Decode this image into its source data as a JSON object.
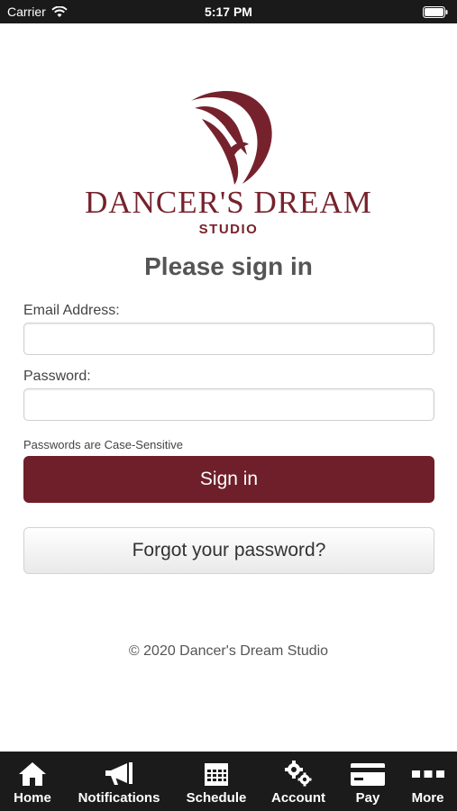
{
  "status_bar": {
    "carrier": "Carrier",
    "time": "5:17 PM"
  },
  "brand": {
    "name": "DANCER'S DREAM",
    "sub": "STUDIO",
    "color": "#76222c",
    "logo_icon": "dancer-swirl-icon"
  },
  "login": {
    "title": "Please sign in",
    "email_label": "Email Address:",
    "email_value": "",
    "password_label": "Password:",
    "password_value": "",
    "hint": "Passwords are Case-Sensitive",
    "sign_in_label": "Sign in",
    "forgot_label": "Forgot your password?"
  },
  "footer": {
    "copyright": "© 2020 Dancer's Dream Studio"
  },
  "tab_bar": {
    "items": [
      {
        "label": "Home",
        "icon": "home-icon"
      },
      {
        "label": "Notifications",
        "icon": "megaphone-icon"
      },
      {
        "label": "Schedule",
        "icon": "calendar-icon"
      },
      {
        "label": "Account",
        "icon": "gears-icon"
      },
      {
        "label": "Pay",
        "icon": "credit-card-icon"
      },
      {
        "label": "More",
        "icon": "more-dots-icon"
      }
    ]
  },
  "colors": {
    "accent": "#6e1f2a",
    "tab_bar_bg": "#1b1b1b"
  }
}
